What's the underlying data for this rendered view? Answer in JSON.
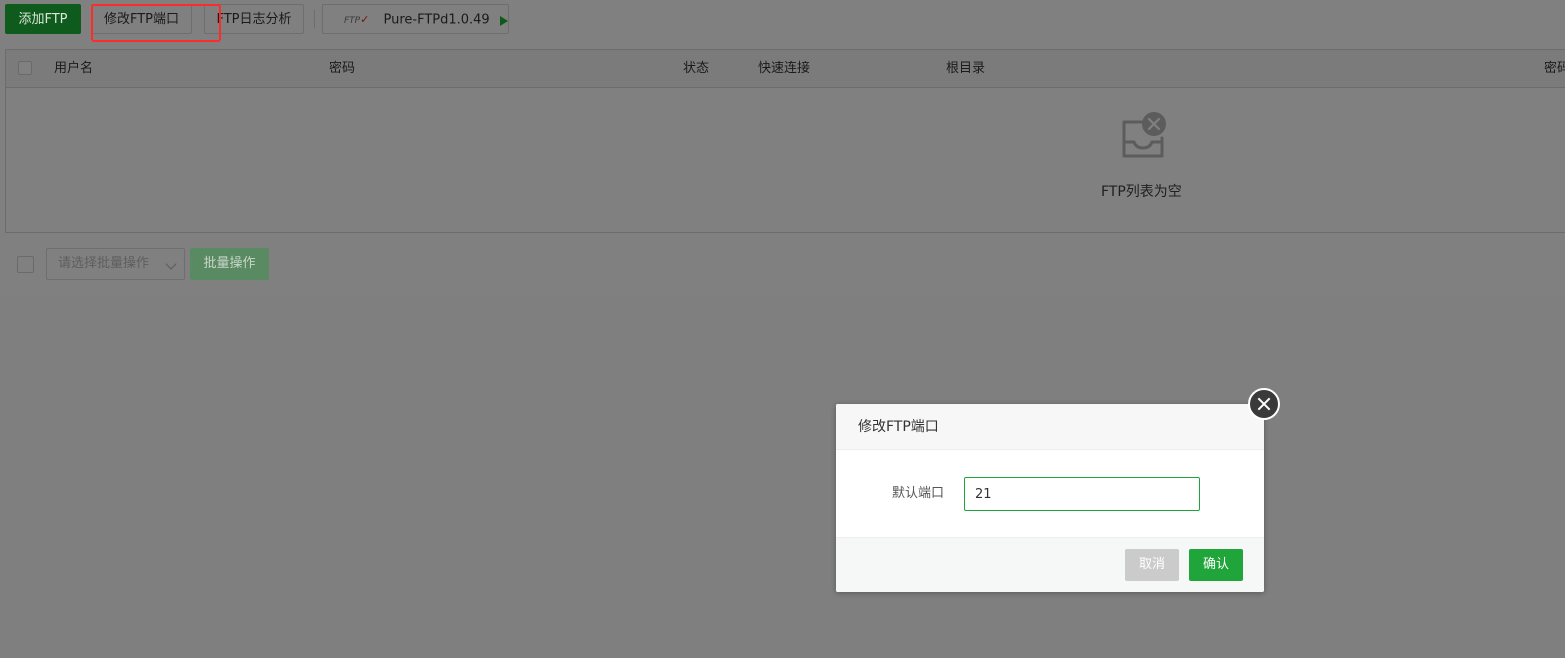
{
  "toolbar": {
    "add_ftp": "添加FTP",
    "modify_port": "修改FTP端口",
    "log_analysis": "FTP日志分析",
    "version_logo": "FTP",
    "version": "Pure-FTPd1.0.49"
  },
  "table": {
    "columns": [
      "用户名",
      "密码",
      "状态",
      "快速连接",
      "根目录",
      "密码"
    ],
    "empty_text": "FTP列表为空"
  },
  "batch": {
    "select_placeholder": "请选择批量操作",
    "button_label": "批量操作"
  },
  "dialog": {
    "title": "修改FTP端口",
    "field_label": "默认端口",
    "field_value": "21",
    "cancel_label": "取消",
    "confirm_label": "确认"
  },
  "colors": {
    "accent_green": "#20a53a",
    "highlight_red": "#ff2a2a",
    "overlay": "#7f7f7f"
  },
  "icons": {
    "empty": "empty-inbox-icon",
    "close": "close-icon",
    "play": "play-icon",
    "dropdown": "chevron-down-icon"
  }
}
